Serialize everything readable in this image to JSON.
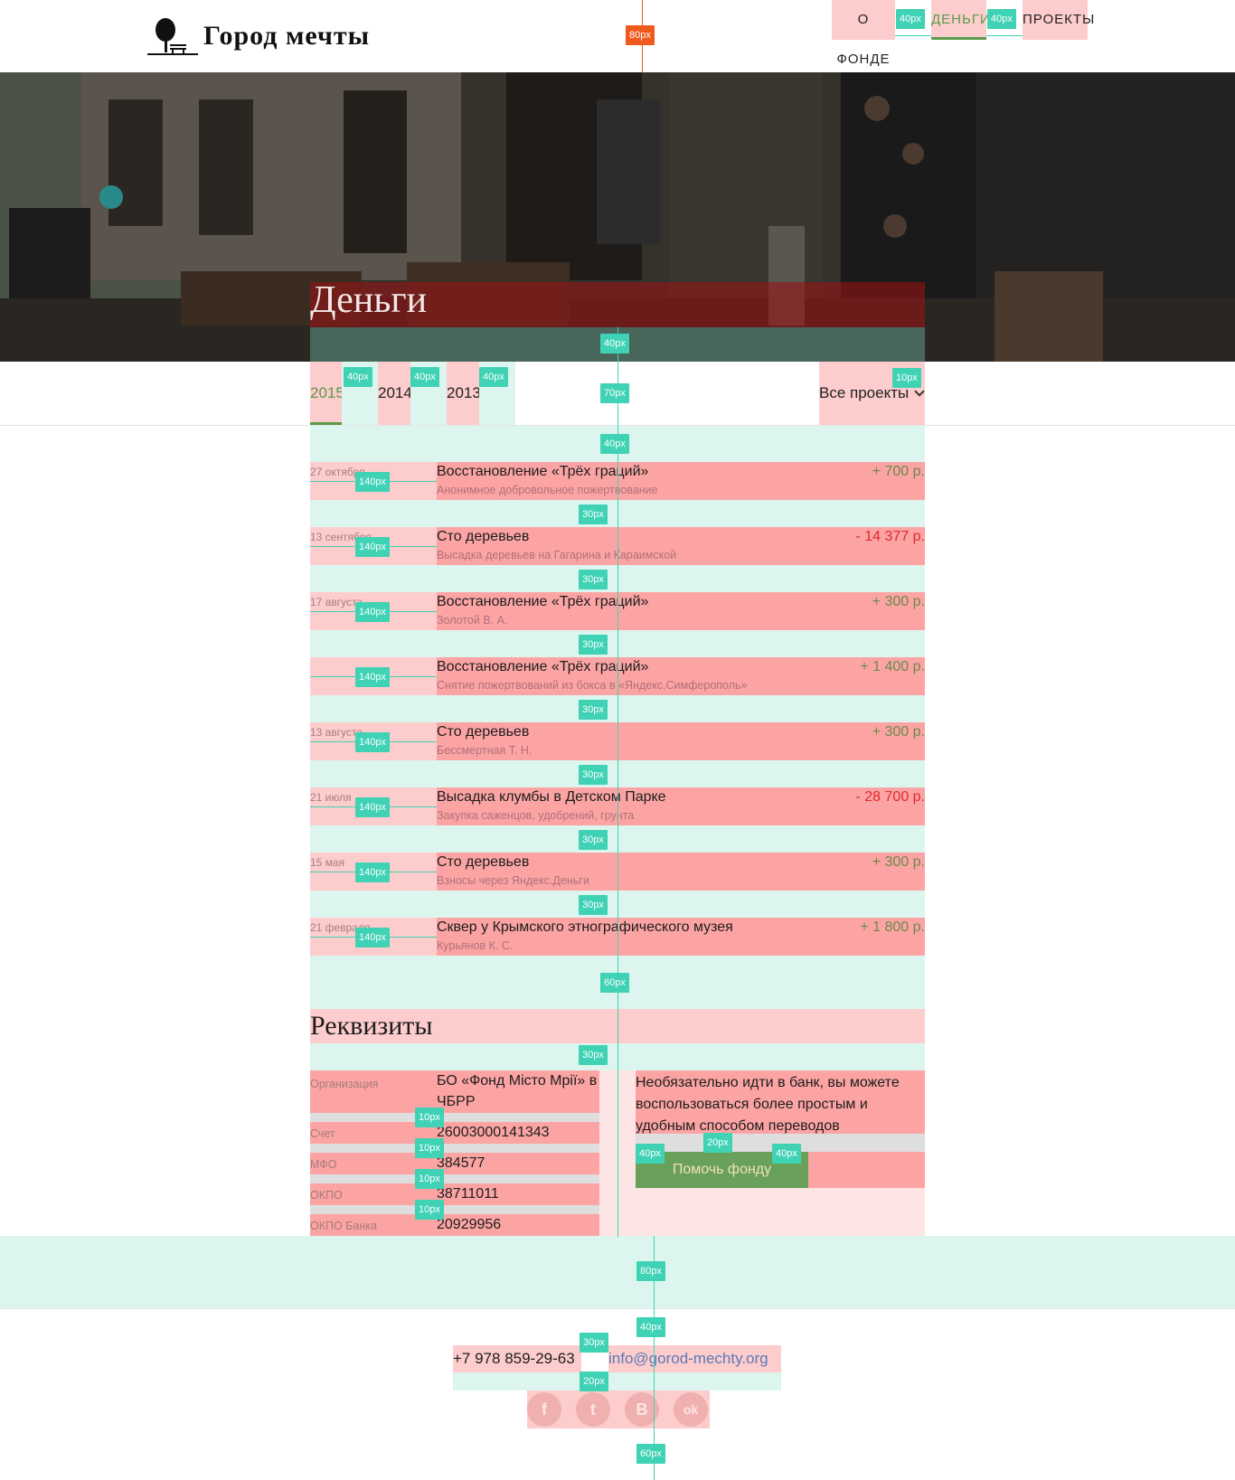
{
  "header": {
    "logo_text": "Город мечты",
    "nav": [
      {
        "label": "О фонде"
      },
      {
        "label": "Деньги"
      },
      {
        "label": "Проекты"
      }
    ]
  },
  "hero": {
    "title": "Деньги"
  },
  "filters": {
    "years": [
      {
        "label": "2015",
        "active": true
      },
      {
        "label": "2014",
        "active": false
      },
      {
        "label": "2013",
        "active": false
      }
    ],
    "projects_select": "Все проекты"
  },
  "transactions": [
    {
      "date": "27 октября",
      "title": "Восстановление «Трёх граций»",
      "desc": "Анонимное добровольное пожертвование",
      "amount": "+ 700 р.",
      "type": "plus"
    },
    {
      "date": "13 сентября",
      "title": "Сто деревьев",
      "desc": "Высадка деревьев на Гагарина и Караимской",
      "amount": "- 14 377 р.",
      "type": "minus"
    },
    {
      "date": "17 августа",
      "title": "Восстановление «Трёх граций»",
      "desc": "Золотой В. А.",
      "amount": "+ 300 р.",
      "type": "plus"
    },
    {
      "date": "",
      "title": "Восстановление «Трёх граций»",
      "desc": "Снятие пожертвований из бокса в «Яндекс.Симферополь»",
      "amount": "+ 1 400 р.",
      "type": "plus"
    },
    {
      "date": "13 августа",
      "title": "Сто деревьев",
      "desc": "Бессмертная Т. Н.",
      "amount": "+ 300 р.",
      "type": "plus"
    },
    {
      "date": "21 июля",
      "title": "Высадка клумбы в Детском Парке",
      "desc": "Закупка саженцов, удобрений, грунта",
      "amount": "- 28 700 р.",
      "type": "minus"
    },
    {
      "date": "15 мая",
      "title": "Сто деревьев",
      "desc": "Взносы через Яндекс.Деньги",
      "amount": "+ 300 р.",
      "type": "plus"
    },
    {
      "date": "21 февраля",
      "title": "Сквер у Крымского этнографического музея",
      "desc": "Курьянов К. С.",
      "amount": "+ 1 800 р.",
      "type": "plus"
    }
  ],
  "requisites": {
    "title": "Реквизиты",
    "rows": [
      {
        "label": "Организация",
        "value": "БО «Фонд Місто Мрії» в ЧБРР"
      },
      {
        "label": "Счет",
        "value": "26003000141343"
      },
      {
        "label": "МФО",
        "value": "384577"
      },
      {
        "label": "ОКПО",
        "value": "38711011"
      },
      {
        "label": "ОКПО Банка",
        "value": "20929956"
      }
    ],
    "note": "Необязательно идти в банк, вы можете воспользоваться более простым и удобным способом переводов",
    "help_button": "Помочь фонду"
  },
  "footer": {
    "phone": "+7 978 859-29-63",
    "email": "info@gorod-mechty.org",
    "socials": [
      {
        "icon": "facebook-icon",
        "glyph": "f"
      },
      {
        "icon": "twitter-icon",
        "glyph": "t"
      },
      {
        "icon": "vk-icon",
        "glyph": "B"
      },
      {
        "icon": "odnoklassniki-icon",
        "glyph": "ok"
      }
    ]
  },
  "measurements": [
    "80px",
    "40px",
    "40px",
    "40px",
    "70px",
    "40px",
    "40px",
    "40px",
    "10px",
    "40px",
    "140px",
    "30px",
    "60px",
    "30px",
    "10px",
    "10px",
    "10px",
    "10px",
    "40px",
    "20px",
    "40px",
    "80px",
    "40px",
    "30px",
    "20px",
    "60px"
  ]
}
